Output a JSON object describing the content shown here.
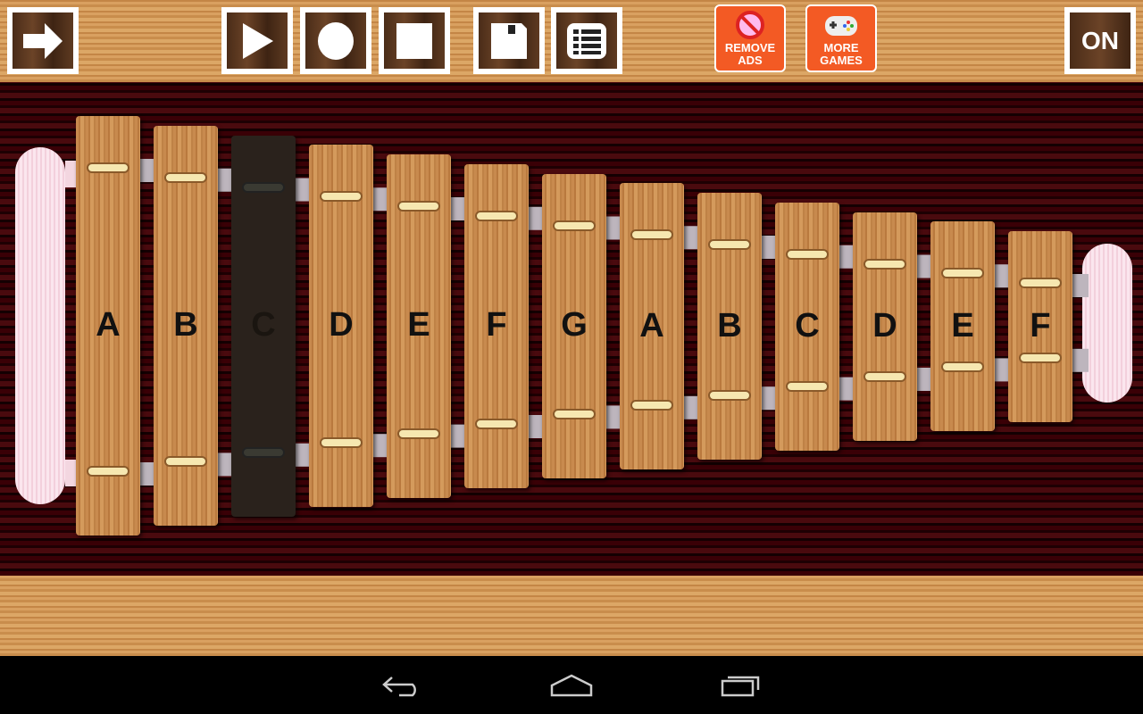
{
  "toolbar": {
    "next_icon": "arrow-right-icon",
    "play_icon": "play-icon",
    "record_icon": "record-icon",
    "stop_icon": "stop-icon",
    "save_icon": "floppy-disk-icon",
    "list_icon": "list-icon",
    "remove_ads": {
      "line1": "REMOVE",
      "line2": "ADS",
      "icon": "no-ads-icon"
    },
    "more_games": {
      "line1": "MORE",
      "line2": "GAMES",
      "icon": "gamepad-icon"
    },
    "power_label": "ON"
  },
  "xylophone": {
    "pressed_index": 2,
    "keys": [
      "A",
      "B",
      "C",
      "D",
      "E",
      "F",
      "G",
      "A",
      "B",
      "C",
      "D",
      "E",
      "F"
    ]
  },
  "colors": {
    "accent": "#f35a24",
    "bar": "#c88a4e",
    "pressed": "#2a221c"
  },
  "navbar": {
    "back_icon": "back-icon",
    "home_icon": "home-icon",
    "recents_icon": "recent-apps-icon"
  }
}
